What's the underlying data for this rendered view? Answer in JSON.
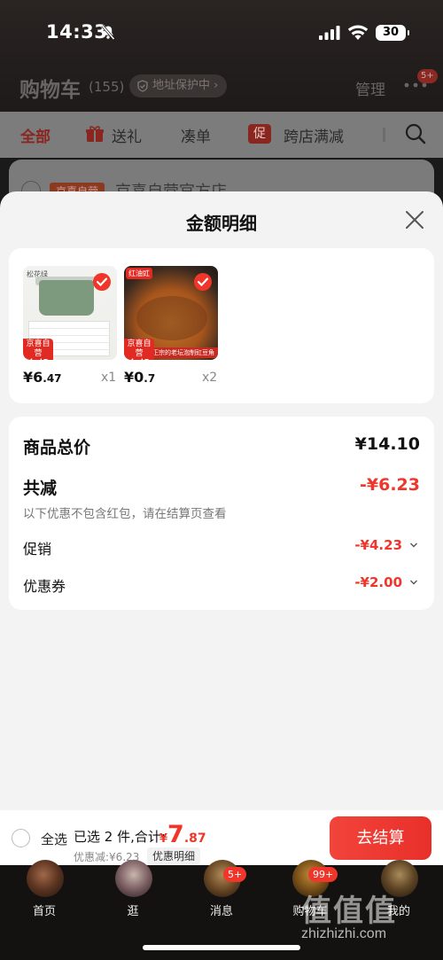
{
  "status_bar": {
    "time": "14:33",
    "battery": "30"
  },
  "header": {
    "title": "购物车",
    "count": "(155)",
    "address_protect": "地址保护中",
    "manage": "管理",
    "more_badge": "5+"
  },
  "filters": [
    {
      "label": "全部",
      "active": true
    },
    {
      "label": "送礼"
    },
    {
      "label": "凑单"
    },
    {
      "label": "跨店满减",
      "tag": "促"
    }
  ],
  "store": {
    "tag": "京喜自营",
    "name": "京喜自营官方店"
  },
  "sheet": {
    "title": "金额明细",
    "items": [
      {
        "brand": "松花绿",
        "tag_line1": "京喜自营",
        "tag_line2": "包邮",
        "price_int": "¥6",
        "price_dec": ".47",
        "qty": "x1"
      },
      {
        "brand": "红油豇",
        "tag_line1": "京喜自营",
        "tag_line2": "包邮",
        "banner": "正宗的老坛泡制豇豆角",
        "price_int": "¥0",
        "price_dec": ".7",
        "qty": "x2"
      }
    ],
    "details": {
      "total_label": "商品总价",
      "total_value": "¥14.10",
      "reduce_label": "共减",
      "reduce_value": "-¥6.23",
      "note": "以下优惠不包含红包，请在结算页查看",
      "promo_label": "促销",
      "promo_value": "-¥4.23",
      "coupon_label": "优惠券",
      "coupon_value": "-¥2.00"
    }
  },
  "checkout": {
    "select_all": "全选",
    "summary": "已选 2 件,合计:",
    "yen": "¥",
    "total_int": "7",
    "total_dec": ".87",
    "discount": "优惠减:¥6.23",
    "detail_link": "优惠明细",
    "pay": "去结算"
  },
  "tabs": [
    {
      "label": "首页"
    },
    {
      "label": "逛"
    },
    {
      "label": "消息",
      "badge": "5+"
    },
    {
      "label": "购物车",
      "badge": "99+"
    },
    {
      "label": "我的"
    }
  ],
  "watermark": {
    "text": "值值值",
    "url": "zhizhizhi.com"
  },
  "colors": {
    "accent": "#f0362a",
    "sheet_bg": "#f3f3f3",
    "card_bg": "#ffffff",
    "nav_bg": "#141210"
  },
  "icons": [
    "bell-muted-icon",
    "signal-icon",
    "wifi-icon",
    "battery-icon",
    "shield-icon",
    "more-icon",
    "gift-icon",
    "search-icon",
    "close-icon",
    "check-icon",
    "chevron-down-icon"
  ]
}
